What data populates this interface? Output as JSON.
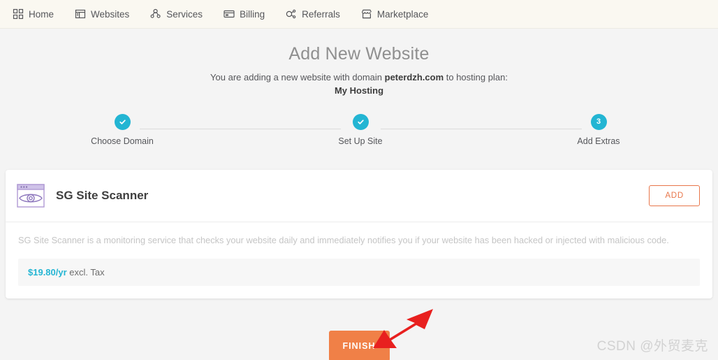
{
  "nav": {
    "items": [
      {
        "label": "Home",
        "icon": "grid-icon"
      },
      {
        "label": "Websites",
        "icon": "browser-window-icon"
      },
      {
        "label": "Services",
        "icon": "people-icon"
      },
      {
        "label": "Billing",
        "icon": "credit-card-icon"
      },
      {
        "label": "Referrals",
        "icon": "share-nodes-icon"
      },
      {
        "label": "Marketplace",
        "icon": "storefront-icon"
      }
    ]
  },
  "header": {
    "title": "Add New Website",
    "subtitle_prefix": "You are adding a new website with domain ",
    "domain": "peterdzh.com",
    "subtitle_suffix": " to hosting plan:",
    "plan": "My Hosting"
  },
  "stepper": {
    "accent_color": "#23b5d3",
    "steps": [
      {
        "label": "Choose Domain",
        "state": "complete",
        "marker": "check-icon"
      },
      {
        "label": "Set Up Site",
        "state": "complete",
        "marker": "check-icon"
      },
      {
        "label": "Add Extras",
        "state": "current",
        "marker": "3"
      }
    ]
  },
  "card": {
    "icon": "site-scanner-eye-icon",
    "title": "SG Site Scanner",
    "add_label": "ADD",
    "add_color": "#e8764a",
    "description": "SG Site Scanner is a monitoring service that checks your website daily and immediately notifies you if your website has been hacked or injected with malicious code.",
    "price_amount": "$19.80/yr",
    "price_note": " excl. Tax",
    "price_color": "#23b5d3"
  },
  "footer": {
    "finish_label": "FINISH",
    "finish_color": "#f08047"
  },
  "annotation": {
    "arrow": "red-arrow-pointing-down-left",
    "arrow_color": "#e8201f"
  },
  "watermark": {
    "text": "CSDN @外贸麦克"
  }
}
